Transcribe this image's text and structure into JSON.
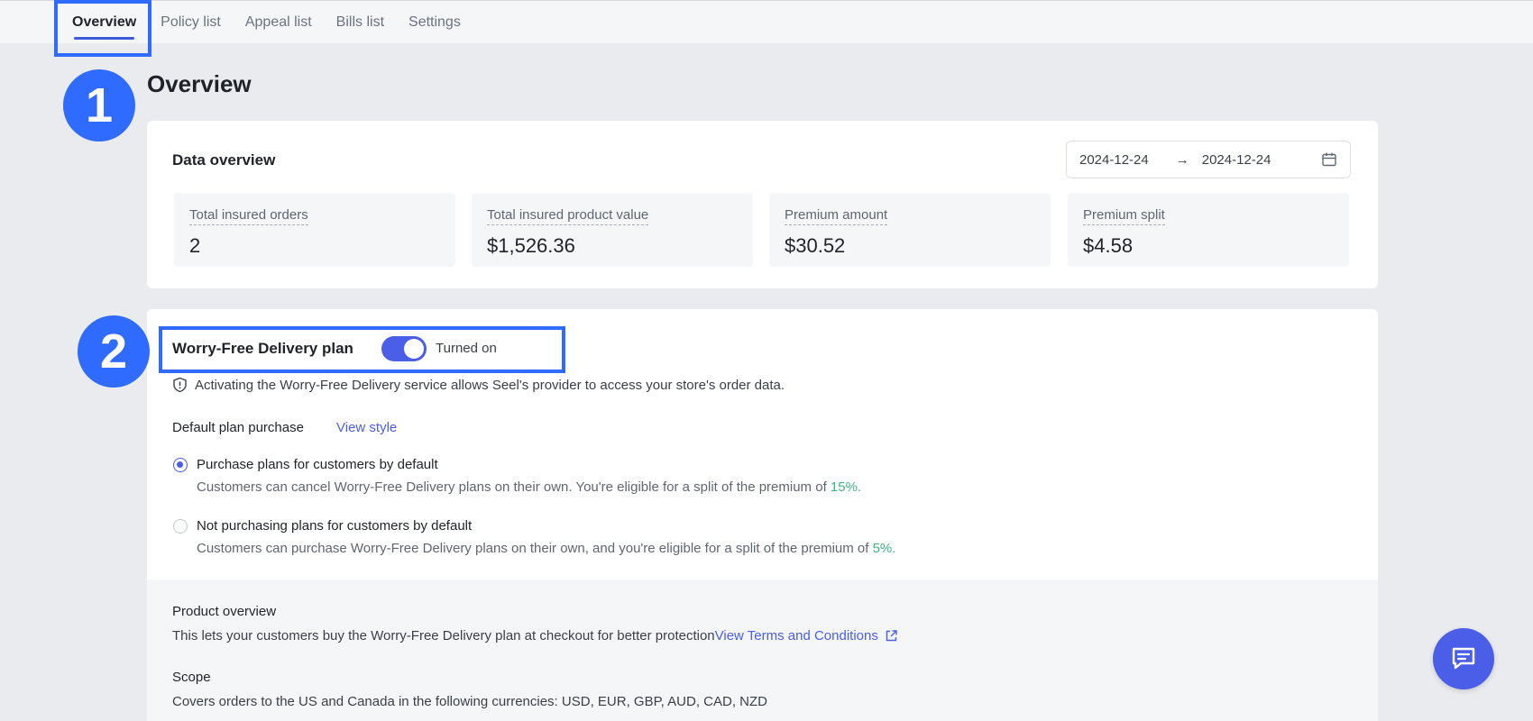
{
  "nav": {
    "tabs": [
      {
        "label": "Overview",
        "active": true
      },
      {
        "label": "Policy list"
      },
      {
        "label": "Appeal list"
      },
      {
        "label": "Bills list"
      },
      {
        "label": "Settings"
      }
    ]
  },
  "steps": {
    "one": "1",
    "two": "2"
  },
  "page": {
    "title": "Overview"
  },
  "data_overview": {
    "title": "Data overview",
    "date_start": "2024-12-24",
    "date_separator": "→",
    "date_end": "2024-12-24",
    "calendar_icon": "calendar-icon",
    "stats": [
      {
        "label": "Total insured orders",
        "value": "2"
      },
      {
        "label": "Total insured product value",
        "value": "$1,526.36"
      },
      {
        "label": "Premium amount",
        "value": "$30.52"
      },
      {
        "label": "Premium split",
        "value": "$4.58"
      }
    ]
  },
  "plan": {
    "title": "Worry-Free Delivery plan",
    "toggle_on": true,
    "toggle_label": "Turned on",
    "notice": "Activating the Worry-Free Delivery service allows Seel's provider to access your store's order data.",
    "default_label": "Default plan purchase",
    "view_style": "View style",
    "options": [
      {
        "title": "Purchase plans for customers by default",
        "desc": "Customers can cancel Worry-Free Delivery plans on their own. You're eligible for a split of the premium of",
        "pct": "15%.",
        "selected": true
      },
      {
        "title": "Not purchasing plans for customers by default",
        "desc": "Customers can purchase Worry-Free Delivery plans on their own, and you're eligible for a split of the premium of",
        "pct": "5%.",
        "selected": false
      }
    ]
  },
  "product": {
    "heading": "Product overview",
    "text": "This lets your customers buy the Worry-Free Delivery plan at checkout for better protection",
    "terms_link": "View Terms and Conditions",
    "scope_heading": "Scope",
    "scope_text": "Covers orders to the US and Canada in the following currencies: USD, EUR, GBP, AUD, CAD, NZD"
  },
  "colors": {
    "accent": "#4a5ee8",
    "highlight": "#2f6bff",
    "green": "#3fb27f"
  },
  "icons": {
    "notice": "shield-icon",
    "external": "external-link-icon",
    "chat": "chat-icon"
  }
}
